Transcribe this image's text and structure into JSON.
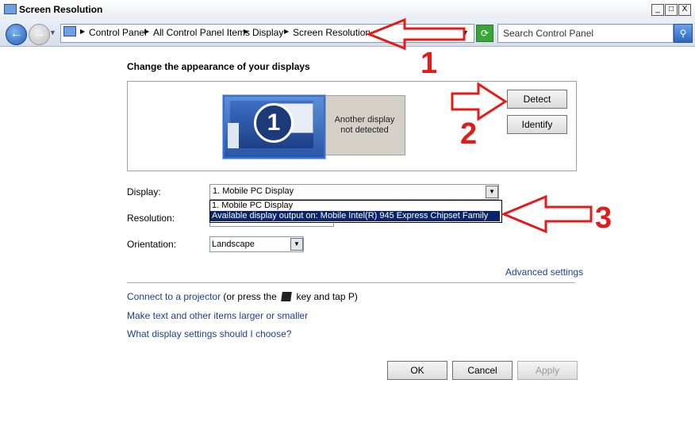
{
  "window": {
    "title": "Screen Resolution",
    "controls": {
      "minimize": "_",
      "maximize": "□",
      "close": "X"
    }
  },
  "nav": {
    "back_icon": "back-arrow-icon",
    "forward_icon": "forward-arrow-icon",
    "breadcrumbs": [
      "Control Panel",
      "All Control Panel Items",
      "Display",
      "Screen Resolution"
    ],
    "search_placeholder": "Search Control Panel"
  },
  "main": {
    "heading": "Change the appearance of your displays",
    "monitors": [
      {
        "number": "1",
        "label": ""
      },
      {
        "number": "",
        "label_line1": "Another display",
        "label_line2": "not detected"
      }
    ],
    "detect_label": "Detect",
    "identify_label": "Identify",
    "display_label": "Display:",
    "display_value": "1. Mobile PC Display",
    "display_options": [
      "1. Mobile PC Display",
      "Available display output on: Mobile Intel(R) 945 Express Chipset Family"
    ],
    "resolution_label": "Resolution:",
    "orientation_label": "Orientation:",
    "orientation_value": "Landscape",
    "advanced_settings": "Advanced settings",
    "link_projector": "Connect to a projector",
    "link_projector_rest_a": "(or press the",
    "link_projector_rest_b": "key and tap P)",
    "link_text_size": "Make text and other items larger or smaller",
    "link_which_settings": "What display settings should I choose?",
    "ok_label": "OK",
    "cancel_label": "Cancel",
    "apply_label": "Apply"
  },
  "annotations": {
    "num1": "1",
    "num2": "2",
    "num3": "3",
    "color": "#e21b1b"
  }
}
